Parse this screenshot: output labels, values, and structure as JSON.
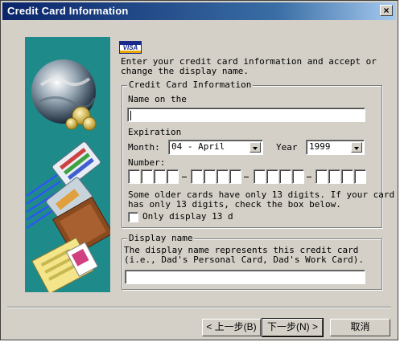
{
  "window": {
    "title": "Credit Card Information",
    "close_glyph": "×"
  },
  "card_logo": {
    "text": "VISA",
    "icon": "visa-card-icon"
  },
  "intro": {
    "line1": "Enter your credit card information and accept or",
    "line2": "change the display name."
  },
  "card_group": {
    "legend": "Credit Card Information",
    "name_label": "Name on the",
    "name_value": "",
    "expiration_label": "Expiration",
    "month_label": "Month:",
    "month_value": "04 - April",
    "year_label": "Year",
    "year_value": "1999",
    "number_label": "Number:",
    "number_groups": 4,
    "note_line1": "Some older cards have only 13 digits. If your card",
    "note_line2": "has only 13 digits, check the box below.",
    "checkbox_label": "Only display 13 d",
    "checkbox_checked": false
  },
  "display_group": {
    "legend": "Display name",
    "line1": "The display name represents this credit card",
    "line2": "(i.e., Dad's Personal Card, Dad's Work Card).",
    "value": ""
  },
  "buttons": {
    "back": "< 上一步(B)",
    "next": "下一步(N) >",
    "cancel": "取消"
  },
  "colors": {
    "title_bar": "#0a246a",
    "art_background": "#1f8a8a",
    "dialog": "#d4d0c8"
  }
}
